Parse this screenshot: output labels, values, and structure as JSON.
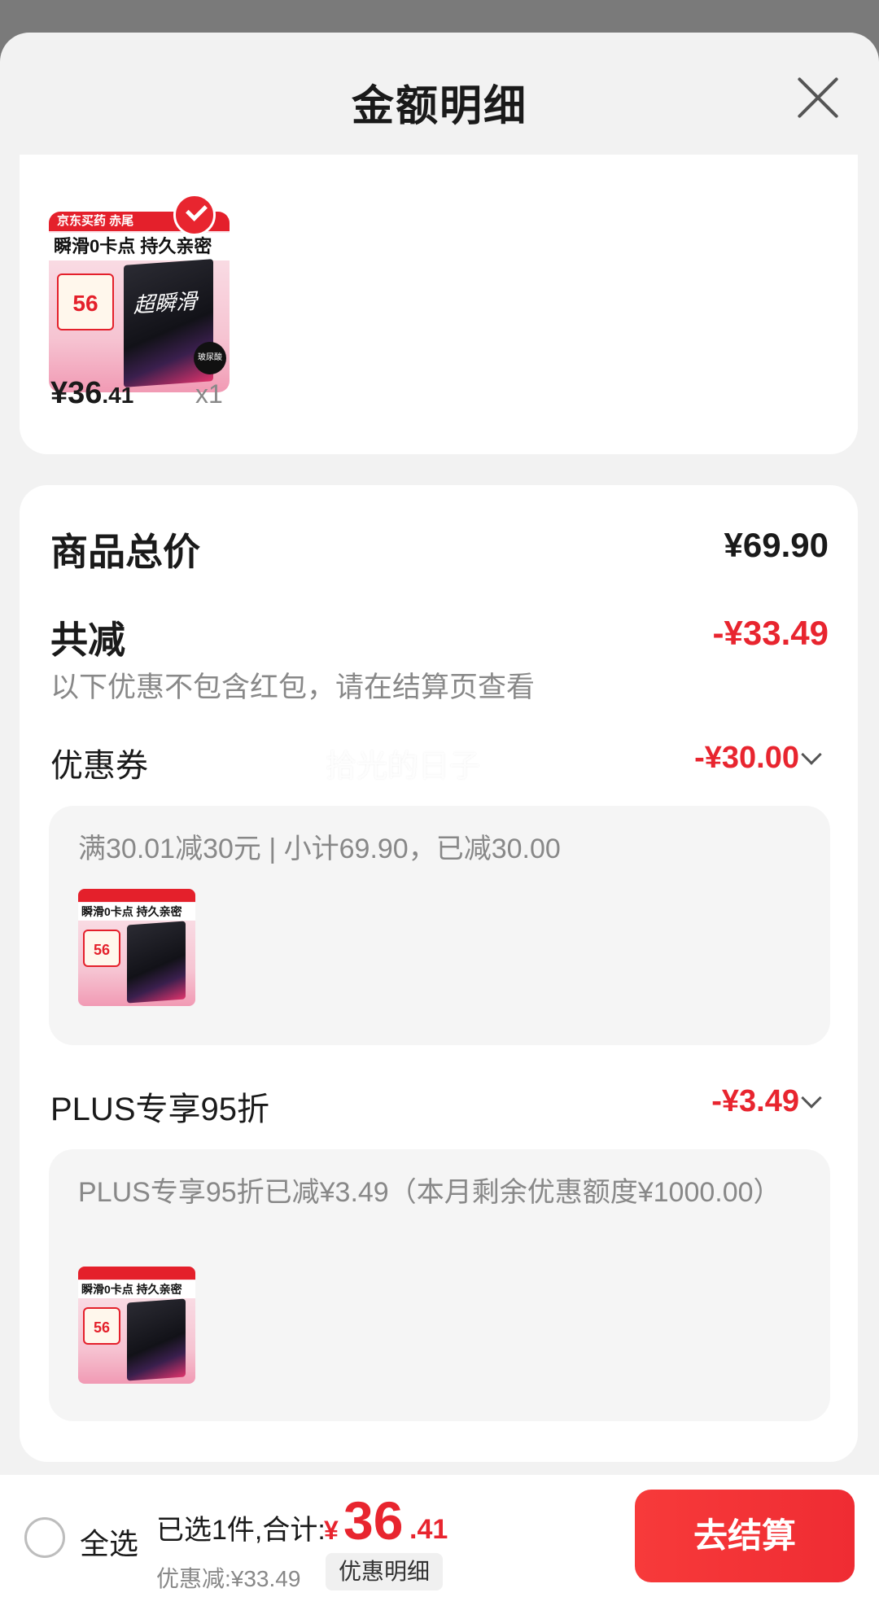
{
  "sheet": {
    "title": "金额明细"
  },
  "product": {
    "thumb": {
      "brand_line": "京东买药  赤尾",
      "headline": "瞬滑0卡点 持久亲密",
      "box_text": "超瞬滑",
      "price_tag": "56",
      "badge": "玻尿酸"
    },
    "price_int": "¥36",
    "price_dec": ".41",
    "quantity": "x1"
  },
  "summary": {
    "total_label": "商品总价",
    "total_value": "¥69.90",
    "discount_label": "共减",
    "discount_value": "-¥33.49",
    "note": "以下优惠不包含红包，请在结算页查看"
  },
  "watermark": "拾光的日子",
  "discounts": [
    {
      "label": "优惠券",
      "value": "-¥30.00",
      "detail": "满30.01减30元 | 小计69.90，已减30.00"
    },
    {
      "label": "PLUS专享95折",
      "value": "-¥3.49",
      "detail": "PLUS专享95折已减¥3.49（本月剩余优惠额度¥1000.00）"
    }
  ],
  "bottom_bar": {
    "select_all": "全选",
    "selected_summary": "已选1件,合计:",
    "total_symbol": "¥",
    "total_int": "36",
    "total_dec": ".41",
    "saved": "优惠减:¥33.49",
    "detail_chip": "优惠明细",
    "checkout": "去结算"
  },
  "colors": {
    "accent": "#e8252f",
    "muted": "#888888",
    "sheet_bg": "#f2f2f2"
  }
}
